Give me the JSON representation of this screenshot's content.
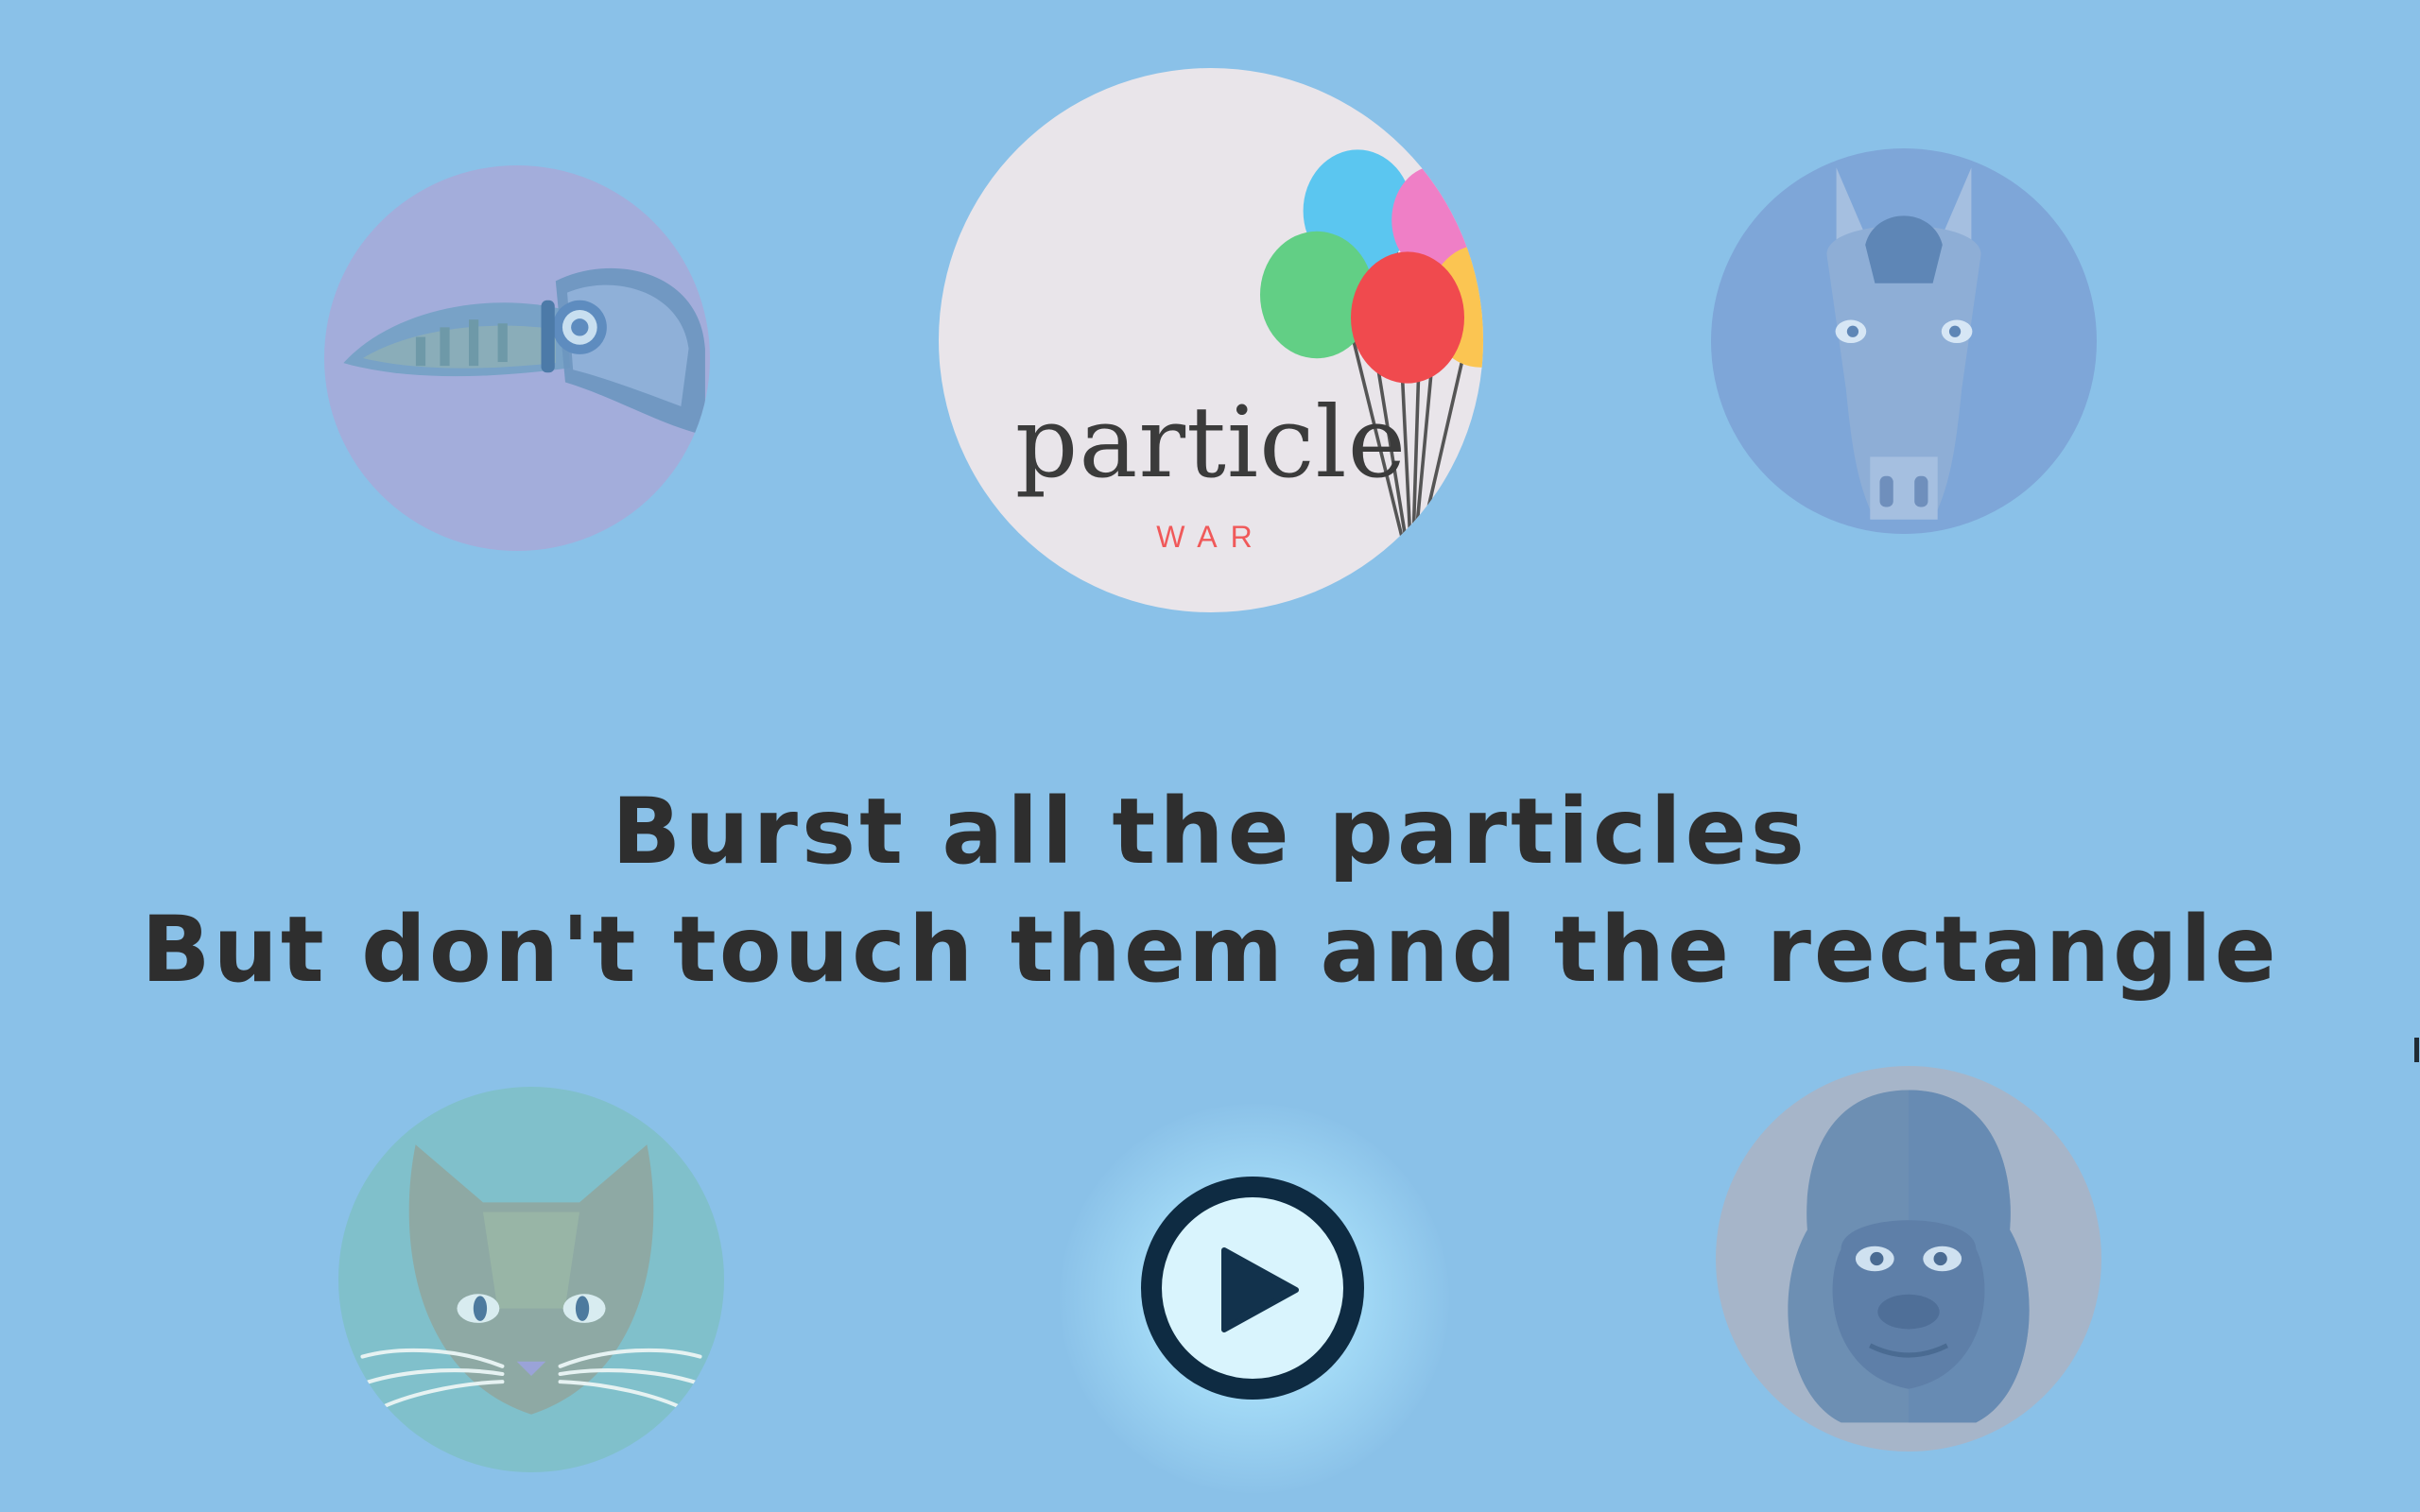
{
  "game": {
    "logo": {
      "title": "particle",
      "subtitle": "WAR"
    },
    "instructions": {
      "line1": "Burst all the particles",
      "line2": "But don't touch them and the rectangle"
    },
    "icons": {
      "toucan": "toucan-icon",
      "horse": "horse-icon",
      "cat": "cat-icon",
      "gorilla": "gorilla-icon",
      "balloons": "balloons-icon",
      "play": "play-icon"
    },
    "colors": {
      "background": "#8ac1e8",
      "text": "#2e2e2e",
      "accent": "#f0595a",
      "play_ring": "#0e2b42"
    }
  }
}
